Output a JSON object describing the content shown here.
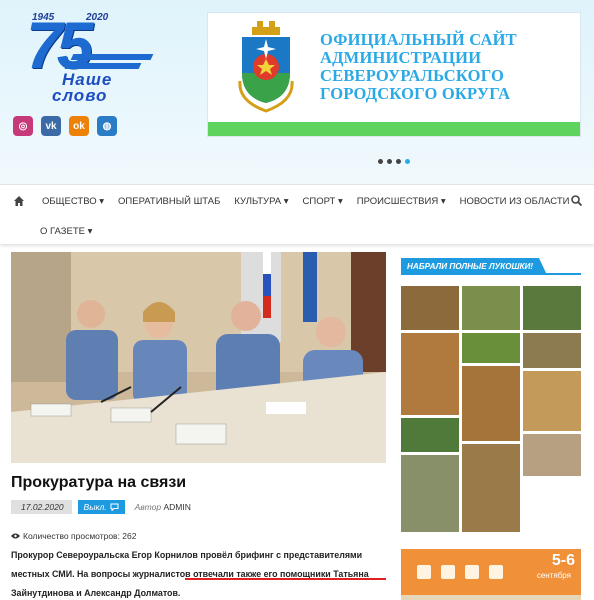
{
  "logo": {
    "year_start": "1945",
    "year_end": "2020",
    "number": "75",
    "line1": "Наше",
    "line2": "слово"
  },
  "socials": [
    {
      "name": "instagram-icon",
      "glyph": "◎"
    },
    {
      "name": "vk-icon",
      "glyph": "vk"
    },
    {
      "name": "odnoklassniki-icon",
      "glyph": "ok"
    },
    {
      "name": "globe-icon",
      "glyph": "◍"
    }
  ],
  "banner": {
    "lines": [
      "ОФИЦИАЛЬНЫЙ САЙТ",
      "АДМИНИСТРАЦИИ",
      "СЕВЕРОУРАЛЬСКОГО",
      "ГОРОДСКОГО ОКРУГА"
    ]
  },
  "slider": {
    "count": 4,
    "active_index": 3
  },
  "nav": {
    "row1": [
      {
        "label": "ОБЩЕСТВО ▾"
      },
      {
        "label": "ОПЕРАТИВНЫЙ ШТАБ"
      },
      {
        "label": "КУЛЬТУРА ▾"
      },
      {
        "label": "СПОРТ ▾"
      },
      {
        "label": "ПРОИСШЕСТВИЯ ▾"
      },
      {
        "label": "НОВОСТИ ИЗ ОБЛАСТИ"
      }
    ],
    "row2": [
      {
        "label": "О ГАЗЕТЕ ▾"
      }
    ]
  },
  "article": {
    "title": "Прокуратура на связи",
    "date": "17.02.2020",
    "comments_label": "Выкл.",
    "author_prefix": "Автор",
    "author": "ADMIN",
    "views": "Количество просмотров: 262",
    "text": "Прокурор Североуральска Егор Корнилов провёл брифинг с представителями местных СМИ. На вопросы журналистов отвечали также его помощники Татьяна Зайнутдинова и Александр Долматов."
  },
  "sidebar": {
    "title": "НАБРАЛИ ПОЛНЫЕ ЛУКОШКИ!"
  },
  "ad": {
    "date": "5-6",
    "month": "сентября"
  },
  "colors": {
    "accent": "#1e9be0",
    "banner_text": "#2aa9e6",
    "banner_green": "#5ed35e",
    "logo_blue": "#1d6bd1",
    "ad_orange": "#f0913a"
  }
}
